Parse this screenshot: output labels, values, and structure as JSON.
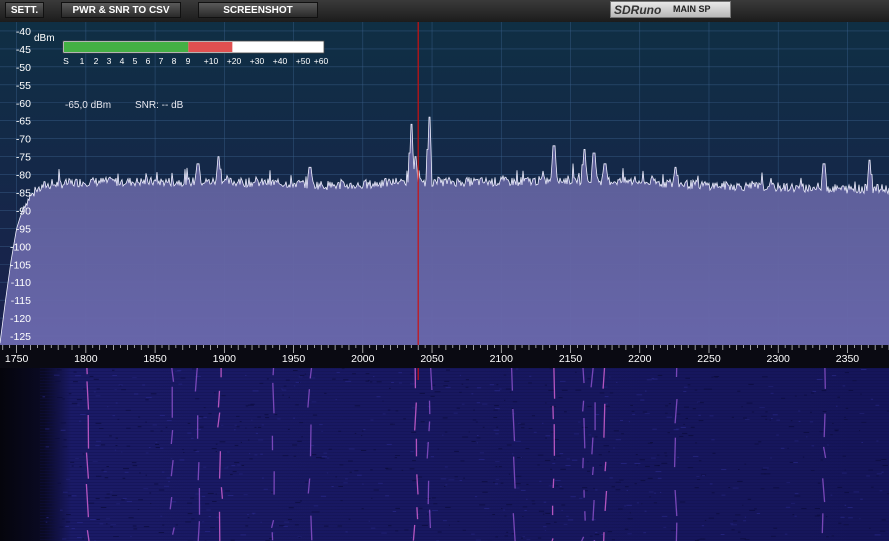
{
  "toolbar": {
    "settings_label": "SETT.",
    "export_label": "PWR & SNR TO CSV",
    "screenshot_label": "SCREENSHOT",
    "brand": "SDRuno",
    "panel_name": "MAIN SP"
  },
  "smeter": {
    "unit": "dBm",
    "scale_labels": [
      "S",
      "1",
      "2",
      "3",
      "4",
      "5",
      "6",
      "7",
      "8",
      "9",
      "+10",
      "+20",
      "+30",
      "+40",
      "+50",
      "+60"
    ],
    "level_fraction_green": 0.48,
    "level_fraction_red": 0.65,
    "colors": {
      "green": "#44b044",
      "red": "#e05050"
    }
  },
  "readout": {
    "power_text": "-65,0 dBm",
    "snr_text": "SNR: -- dB"
  },
  "chart_data": {
    "type": "area",
    "title": "",
    "xlabel": "",
    "ylabel": "dBm",
    "y_ticks": [
      -40,
      -45,
      -50,
      -55,
      -60,
      -65,
      -70,
      -75,
      -80,
      -85,
      -90,
      -95,
      -100,
      -105,
      -110,
      -115,
      -120,
      -125
    ],
    "x_ticks": [
      1750,
      1800,
      1850,
      1900,
      1950,
      2000,
      2050,
      2100,
      2150,
      2200,
      2250,
      2300,
      2350
    ],
    "xlim": [
      1738,
      2380
    ],
    "ylim": [
      -127.5,
      -37.5
    ],
    "marker_frequency": 2040,
    "noise_floor": [
      [
        1738,
        -127
      ],
      [
        1742,
        -115
      ],
      [
        1746,
        -104
      ],
      [
        1750,
        -95
      ],
      [
        1755,
        -89
      ],
      [
        1760,
        -86
      ],
      [
        1770,
        -83
      ],
      [
        1800,
        -82
      ],
      [
        1850,
        -82
      ],
      [
        1900,
        -82
      ],
      [
        1950,
        -82.5
      ],
      [
        1975,
        -83
      ],
      [
        2000,
        -83
      ],
      [
        2025,
        -82
      ],
      [
        2050,
        -82
      ],
      [
        2100,
        -82
      ],
      [
        2150,
        -81.5
      ],
      [
        2200,
        -82
      ],
      [
        2250,
        -83
      ],
      [
        2300,
        -83.5
      ],
      [
        2350,
        -84
      ],
      [
        2380,
        -84
      ]
    ],
    "peaks": [
      [
        1881,
        -77
      ],
      [
        1896,
        -75
      ],
      [
        1962,
        -78
      ],
      [
        2035,
        -66
      ],
      [
        2038,
        -75
      ],
      [
        2048,
        -64
      ],
      [
        2138,
        -72
      ],
      [
        2160,
        -73
      ],
      [
        2167,
        -74
      ],
      [
        2175,
        -77
      ],
      [
        2226,
        -78
      ],
      [
        2333,
        -77
      ],
      [
        2366,
        -76
      ]
    ],
    "colors": {
      "trace": "#f0f0ff",
      "fill": "#6a6aa6",
      "marker": "#cc1111",
      "grid": "#3a5f8a",
      "bg_top": "#0f2f44",
      "bg_bottom": "#1b1f4e"
    }
  },
  "waterfall": {
    "signal_frequencies": [
      1801,
      1863,
      1881,
      1897,
      1935,
      1962,
      2038,
      2048,
      2108,
      2138,
      2160,
      2167,
      2175,
      2226,
      2333
    ]
  }
}
